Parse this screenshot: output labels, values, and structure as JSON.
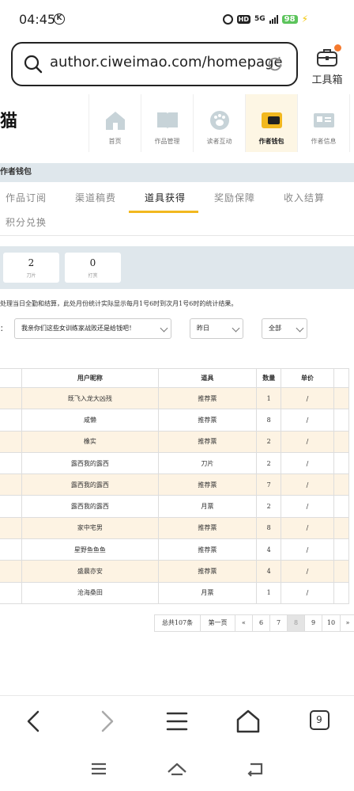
{
  "status": {
    "time": "04:45",
    "k_badge": "K",
    "hd": "HD",
    "signal": "5G",
    "battery": "98"
  },
  "browser": {
    "url": "author.ciweimao.com/homepage",
    "toolbox_label": "工具箱",
    "tab_count": "9"
  },
  "site": {
    "brand_char": "猫",
    "nav": [
      {
        "label": "首页",
        "icon": "house-icon"
      },
      {
        "label": "作品管理",
        "icon": "book-icon"
      },
      {
        "label": "读者互动",
        "icon": "paw-icon"
      },
      {
        "label": "作者钱包",
        "icon": "wallet-icon",
        "active": true
      },
      {
        "label": "作者信息",
        "icon": "id-card-icon"
      }
    ]
  },
  "section_title": "作者钱包",
  "tabs": [
    "作品订阅",
    "渠道稿费",
    "道具获得",
    "奖励保障",
    "收入结算",
    "积分兑换"
  ],
  "active_tab": "道具获得",
  "summary": [
    {
      "value": "2",
      "label": "刀片"
    },
    {
      "value": "0",
      "label": "打赏"
    }
  ],
  "note": "处理当日全勤和结算，此处月份统计实际显示每月1号6时到次月1号6时的统计结果。",
  "filters": {
    "colon": "：",
    "book": "我亲你们这些女训练家战败还是给钱吧！",
    "date": "昨日",
    "type": "全部"
  },
  "table": {
    "headers": [
      "用户昵称",
      "道具",
      "数量",
      "单价"
    ],
    "rows": [
      [
        "既飞入龙大凶残",
        "推荐票",
        "1",
        "/"
      ],
      [
        "咸懒",
        "推荐票",
        "8",
        "/"
      ],
      [
        "橡实",
        "推荐票",
        "2",
        "/"
      ],
      [
        "露西我的露西",
        "刀片",
        "2",
        "/"
      ],
      [
        "露西我的露西",
        "推荐票",
        "7",
        "/"
      ],
      [
        "露西我的露西",
        "月票",
        "2",
        "/"
      ],
      [
        "家中宅男",
        "推荐票",
        "8",
        "/"
      ],
      [
        "星野鱼鱼鱼",
        "推荐票",
        "4",
        "/"
      ],
      [
        "盛晨亦安",
        "推荐票",
        "4",
        "/"
      ],
      [
        "沧海桑田",
        "月票",
        "1",
        "/"
      ]
    ]
  },
  "pagination": {
    "total": "总共107条",
    "first": "第一页",
    "prev": "«",
    "pages": [
      "6",
      "7",
      "8",
      "9",
      "10"
    ],
    "current": "8",
    "next": "»"
  }
}
